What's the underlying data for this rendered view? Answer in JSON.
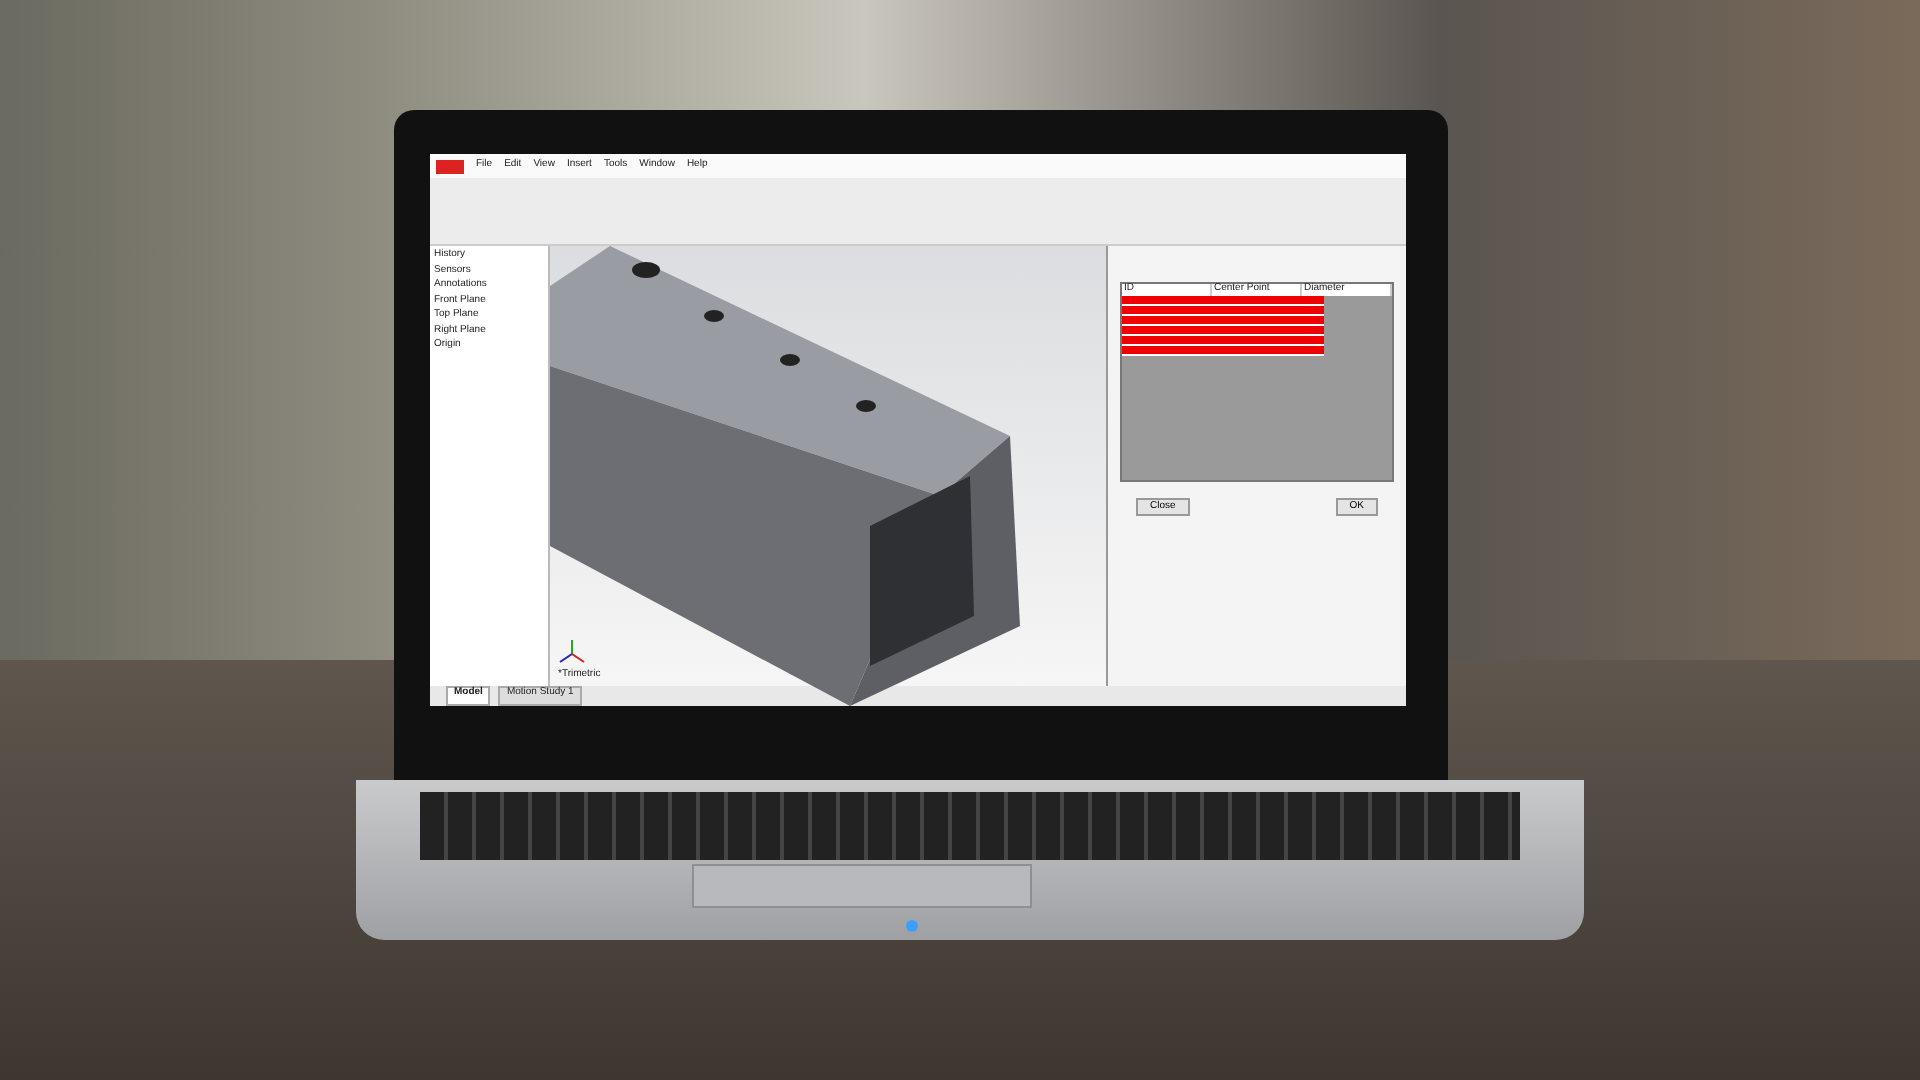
{
  "menu": [
    "File",
    "Edit",
    "View",
    "Insert",
    "Tools",
    "Window",
    "Help"
  ],
  "feature_tree": [
    {
      "label": "History"
    },
    {
      "label": "Sensors"
    },
    {
      "label": "Annotations"
    },
    {
      "label": "Front Plane"
    },
    {
      "label": "Top Plane"
    },
    {
      "label": "Right Plane"
    },
    {
      "label": "Origin"
    }
  ],
  "view_label": "*Trimetric",
  "bottom_tabs": [
    {
      "label": "Model",
      "selected": true
    },
    {
      "label": "Motion Study 1",
      "selected": false
    }
  ],
  "dialog": {
    "columns": [
      "ID",
      "Center Point",
      "Diameter"
    ],
    "rows": [
      {
        "failed": true
      },
      {
        "failed": true
      },
      {
        "failed": true
      },
      {
        "failed": true
      },
      {
        "failed": true
      },
      {
        "failed": true
      }
    ],
    "buttons": [
      "Close",
      "OK"
    ]
  }
}
